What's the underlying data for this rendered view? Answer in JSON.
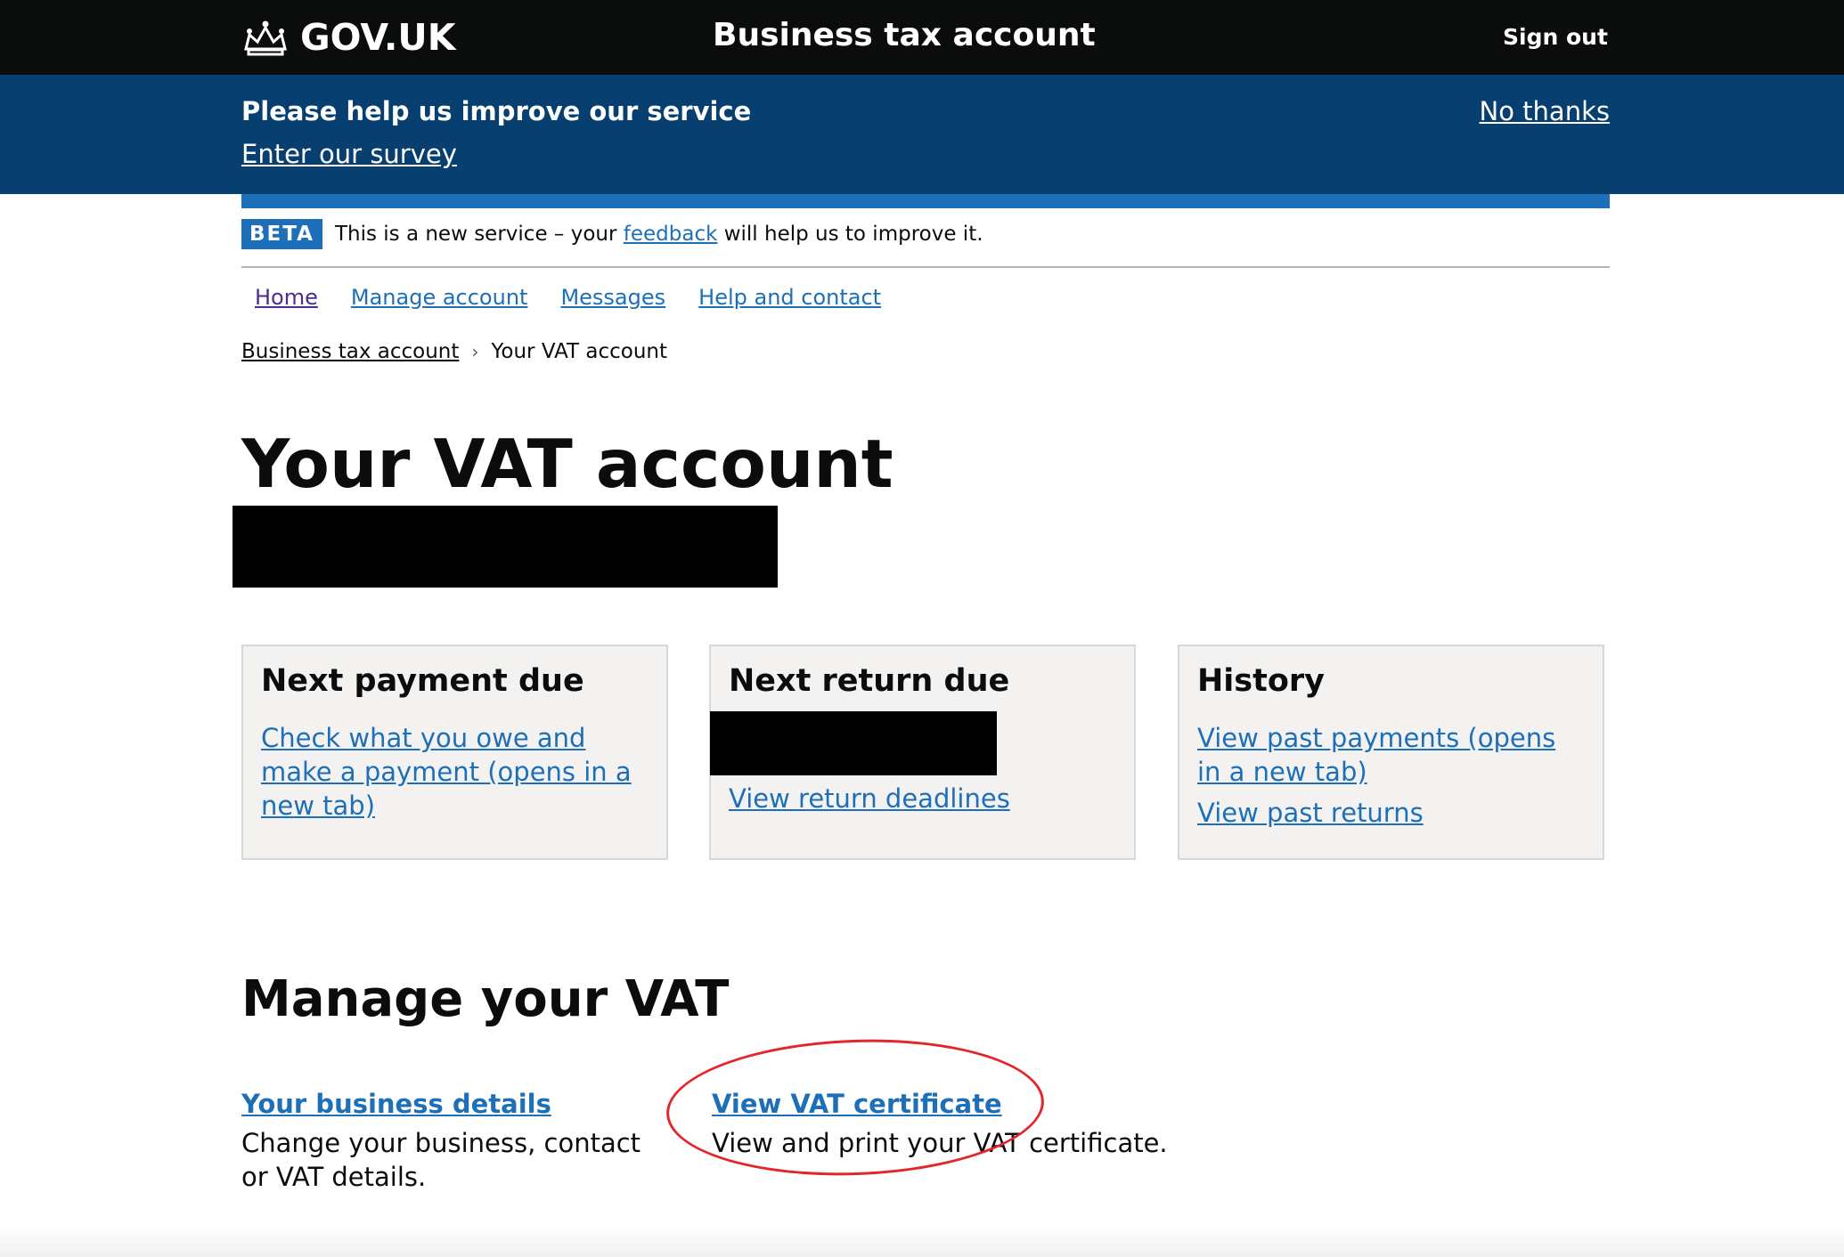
{
  "header": {
    "logo_text": "GOV.UK",
    "service_name": "Business tax account",
    "sign_out": "Sign out"
  },
  "survey": {
    "title": "Please help us improve our service",
    "link": "Enter our survey",
    "no_thanks": "No thanks"
  },
  "beta": {
    "tag": "BETA",
    "text_before": "This is a new service – your",
    "link": "feedback",
    "text_after": "will help us to improve it."
  },
  "nav": {
    "items": [
      "Home",
      "Manage account",
      "Messages",
      "Help and contact"
    ]
  },
  "breadcrumb": {
    "parent": "Business tax account",
    "current": "Your VAT account"
  },
  "page": {
    "title": "Your VAT account"
  },
  "cards": [
    {
      "title": "Next payment due",
      "link": "Check what you owe and make a payment (opens in a new tab)"
    },
    {
      "title": "Next return due",
      "link": "View return deadlines"
    },
    {
      "title": "History",
      "link1": "View past payments (opens in a new tab)",
      "link2": "View past returns"
    }
  ],
  "manage": {
    "title": "Manage your VAT",
    "items": [
      {
        "link": "Your business details",
        "desc": "Change your business, contact or VAT details."
      },
      {
        "link": "View VAT certificate",
        "desc": "View and print your VAT certificate."
      }
    ]
  },
  "colors": {
    "header_bg": "#0b0c0c",
    "survey_bg": "#063f70",
    "link": "#1d70b8",
    "annotation_circle": "#e3262b"
  }
}
